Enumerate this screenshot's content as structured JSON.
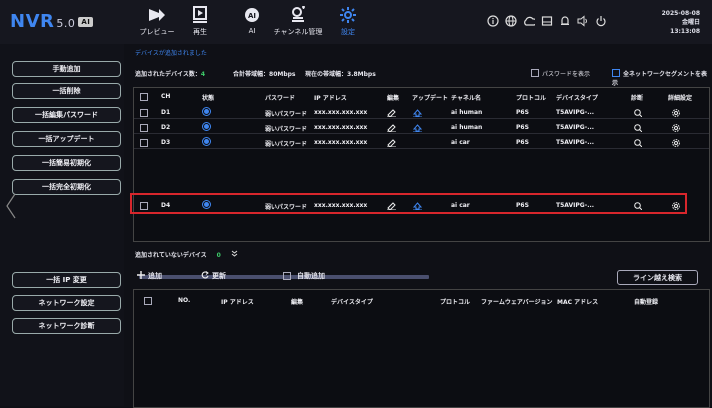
{
  "header": {
    "logo": "NVR",
    "version": "5.0",
    "logo_badge": "AI",
    "nav": [
      {
        "label": "プレビュー",
        "icon": "preview-icon"
      },
      {
        "label": "再生",
        "icon": "playback-icon"
      },
      {
        "label": "AI",
        "icon": "ai-icon"
      },
      {
        "label": "チャンネル管理",
        "icon": "channel-management-icon"
      },
      {
        "label": "設定",
        "icon": "settings-icon",
        "active": true
      }
    ],
    "right_icons": [
      "info-icon",
      "globe-icon",
      "cloud-icon",
      "storage-icon",
      "notification-icon",
      "volume-icon",
      "power-icon"
    ],
    "date": "2025-08-08",
    "weekday": "金曜日",
    "time": "13:13:08"
  },
  "sidebar": {
    "buttons": [
      "手動追加",
      "一括削除",
      "一括編集パスワード",
      "一括アップデート",
      "一括簡易初期化",
      "一括完全初期化",
      "一括 IP 変更",
      "ネットワーク設定",
      "ネットワーク診断"
    ]
  },
  "main": {
    "breadcrumb": "デバイスが追加されました",
    "added_count_label": "追加されたデバイス数：",
    "added_count": "4",
    "total_bw_label": "合計帯域幅：",
    "total_bw": "80Mbps",
    "current_bw_label": "現在の帯域幅：",
    "current_bw": "3.8Mbps",
    "show_password": "パスワードを表示",
    "all_segments": "全ネットワークセグメントを表示",
    "added_table": {
      "headers": [
        "CH",
        "状態",
        "パスワード",
        "IP アドレス",
        "編集",
        "アップデート",
        "チャネル名",
        "プロトコル",
        "デバイスタイプ",
        "診断",
        "詳細設定"
      ],
      "rows": [
        {
          "ch": "D1",
          "password": "弱いパスワード",
          "ip": "xxx.xxx.xxx.xxx",
          "name": "ai human",
          "protocol": "P6S",
          "type": "T5AVIPG-..."
        },
        {
          "ch": "D2",
          "password": "弱いパスワード",
          "ip": "xxx.xxx.xxx.xxx",
          "name": "ai human",
          "protocol": "P6S",
          "type": "T5AVIPG-..."
        },
        {
          "ch": "D3",
          "password": "弱いパスワード",
          "ip": "xxx.xxx.xxx.xxx",
          "name": "ai car",
          "protocol": "P6S",
          "type": "T5AVIPG-..."
        },
        {
          "ch": "D4",
          "password": "弱いパスワード",
          "ip": "xxx.xxx.xxx.xxx",
          "name": "ai car",
          "protocol": "P6S",
          "type": "T5AVIPG-..."
        }
      ]
    },
    "unadded_label": "追加されていないデバイス",
    "unadded_count": "0",
    "toolbar": {
      "add": "追加",
      "refresh": "更新",
      "auto_add": "自動追加",
      "line_search": "ライン越え検索"
    },
    "unadded_table": {
      "headers": [
        "NO.",
        "IP アドレス",
        "編集",
        "デバイスタイプ",
        "プロトコル",
        "ファームウェアバージョン",
        "MAC アドレス",
        "自動登録"
      ]
    }
  }
}
